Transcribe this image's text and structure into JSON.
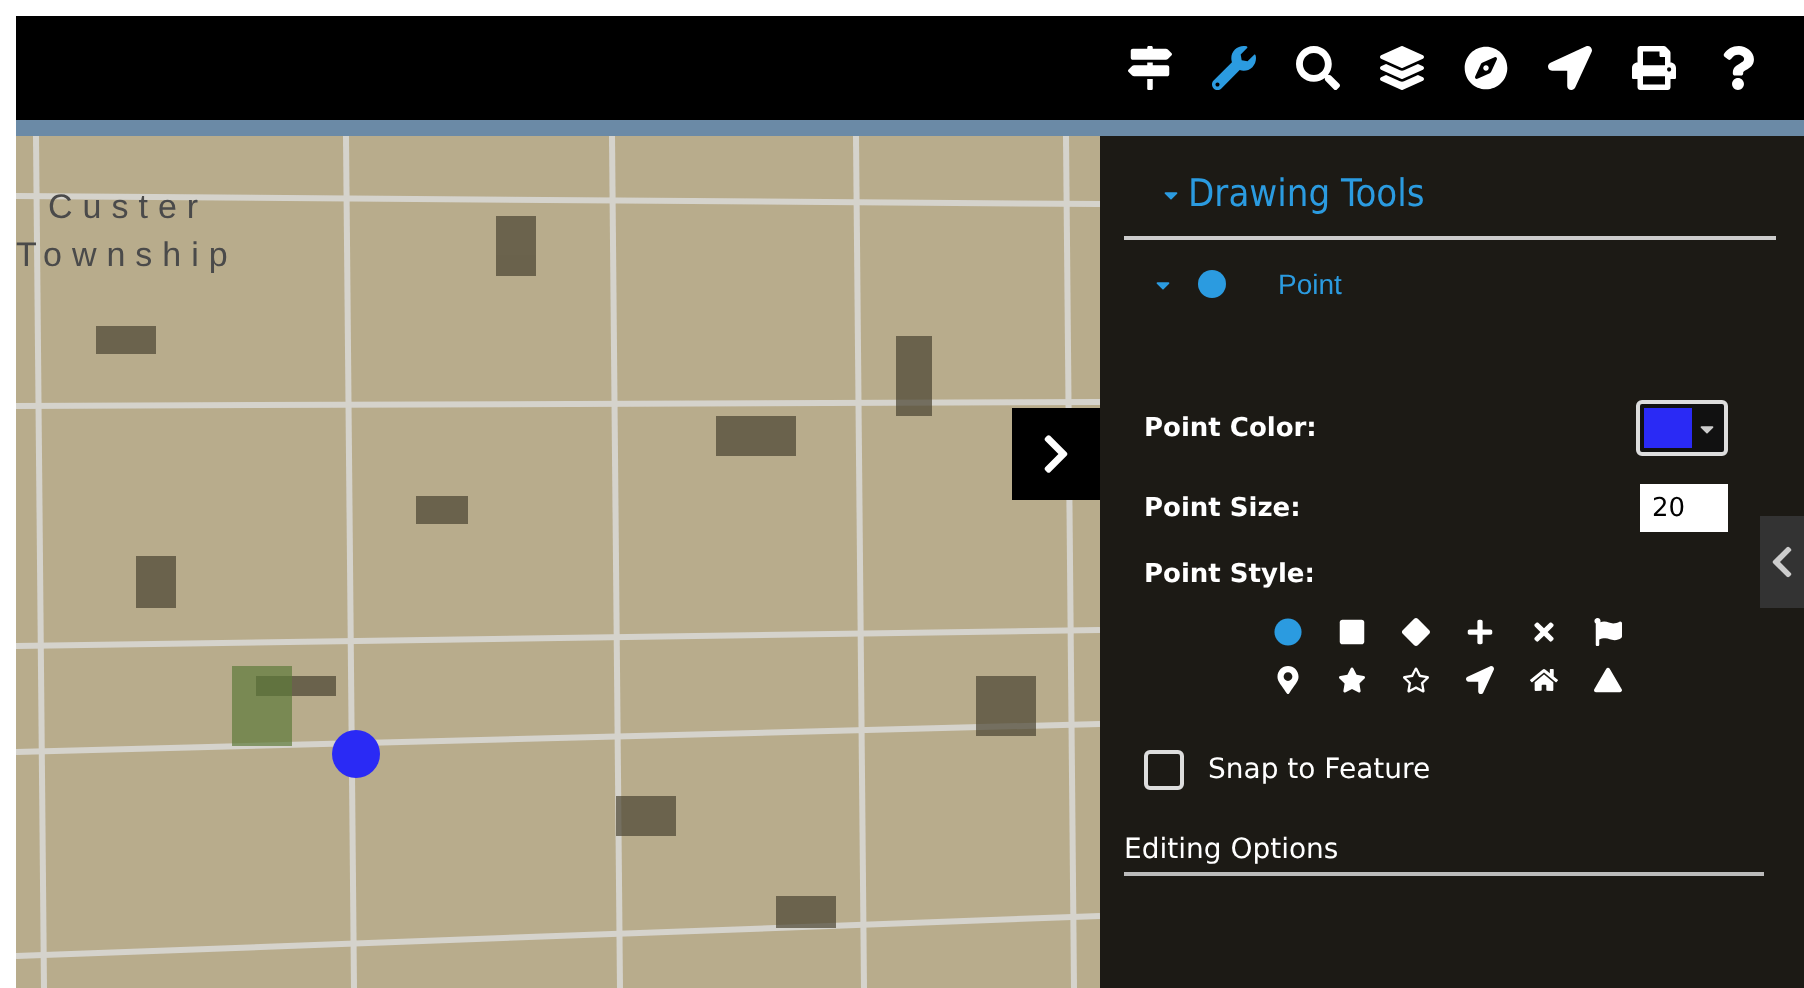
{
  "toolbar": {
    "tools": [
      {
        "kind": "signpost",
        "selected": false
      },
      {
        "kind": "wrench",
        "selected": true
      },
      {
        "kind": "search",
        "selected": false
      },
      {
        "kind": "layers",
        "selected": false
      },
      {
        "kind": "compass",
        "selected": false
      },
      {
        "kind": "send",
        "selected": false
      },
      {
        "kind": "print",
        "selected": false
      },
      {
        "kind": "help",
        "selected": false
      }
    ]
  },
  "map": {
    "labels": [
      "Custer",
      "Township"
    ]
  },
  "panel": {
    "title": "Drawing Tools",
    "expanded": true,
    "section": {
      "label": "Point",
      "expanded": true
    },
    "fields": [
      {
        "kind": "color",
        "label": "Point Color:",
        "color": "#2a2af5"
      },
      {
        "kind": "number",
        "label": "Point Size:",
        "value": "20"
      }
    ],
    "style_label": "Point Style:",
    "styles": [
      {
        "kind": "circle",
        "selected": true
      },
      {
        "kind": "square",
        "selected": false
      },
      {
        "kind": "diamond",
        "selected": false
      },
      {
        "kind": "cross",
        "selected": false
      },
      {
        "kind": "x",
        "selected": false
      },
      {
        "kind": "flag",
        "selected": false
      },
      {
        "kind": "pin",
        "selected": false
      },
      {
        "kind": "star",
        "selected": false
      },
      {
        "kind": "star-outline",
        "selected": false
      },
      {
        "kind": "arrow",
        "selected": false
      },
      {
        "kind": "house",
        "selected": false
      },
      {
        "kind": "triangle",
        "selected": false
      }
    ],
    "snap": {
      "label": "Snap to Feature",
      "checked": false
    },
    "editing_options": "Editing Options"
  }
}
